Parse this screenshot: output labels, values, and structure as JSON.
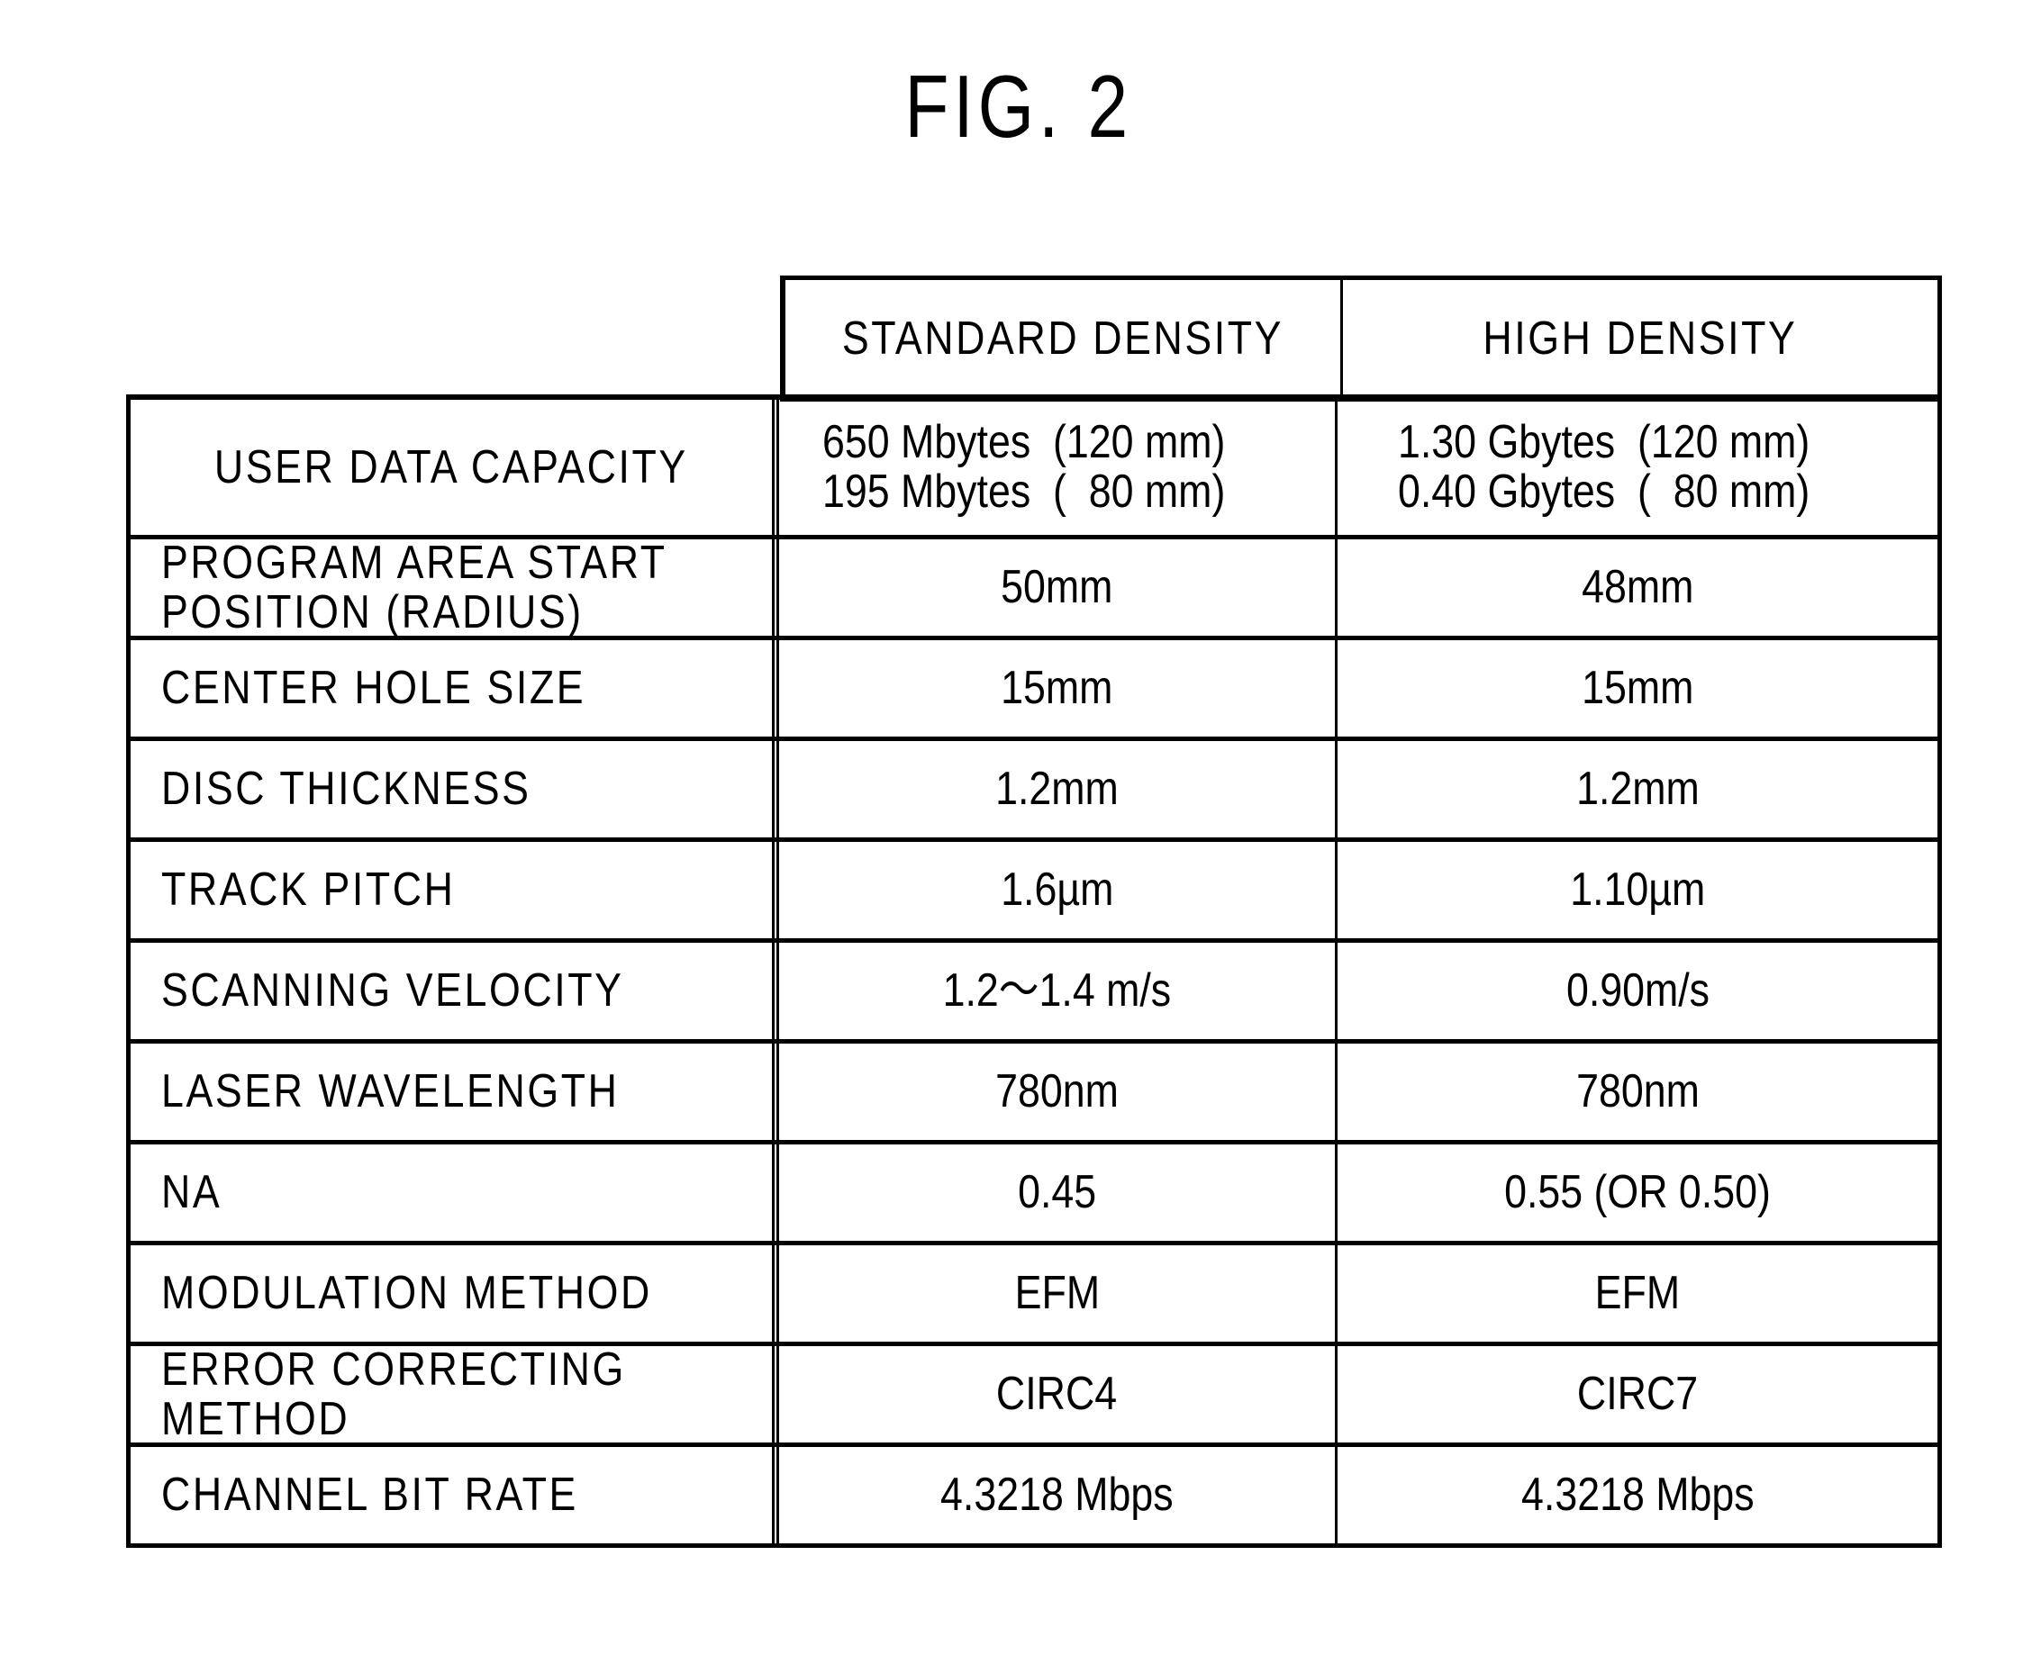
{
  "figure": {
    "title": "FIG. 2"
  },
  "table": {
    "columns": [
      "STANDARD DENSITY",
      "HIGH DENSITY"
    ],
    "rows": [
      {
        "label": "USER DATA CAPACITY",
        "standard": [
          "650 Mbytes  (120 mm)",
          "195 Mbytes  (  80 mm)"
        ],
        "high": [
          "1.30 Gbytes  (120 mm)",
          "0.40 Gbytes  (  80 mm)"
        ]
      },
      {
        "label_lines": [
          "PROGRAM AREA START",
          "POSITION (RADIUS)"
        ],
        "standard": "50mm",
        "high": "48mm"
      },
      {
        "label": "CENTER HOLE SIZE",
        "standard": "15mm",
        "high": "15mm"
      },
      {
        "label": "DISC THICKNESS",
        "standard": "1.2mm",
        "high": "1.2mm"
      },
      {
        "label": "TRACK PITCH",
        "standard": "1.6µm",
        "high": "1.10µm"
      },
      {
        "label": "SCANNING VELOCITY",
        "standard": "1.2～1.4 m/s",
        "high": "0.90m/s"
      },
      {
        "label": "LASER WAVELENGTH",
        "standard": "780nm",
        "high": "780nm"
      },
      {
        "label": "NA",
        "standard": "0.45",
        "high": "0.55 (OR 0.50)"
      },
      {
        "label": "MODULATION METHOD",
        "standard": "EFM",
        "high": "EFM"
      },
      {
        "label_lines": [
          "ERROR CORRECTING",
          "METHOD"
        ],
        "standard": "CIRC4",
        "high": "CIRC7"
      },
      {
        "label": "CHANNEL BIT RATE",
        "standard": "4.3218 Mbps",
        "high": "4.3218 Mbps"
      }
    ]
  }
}
